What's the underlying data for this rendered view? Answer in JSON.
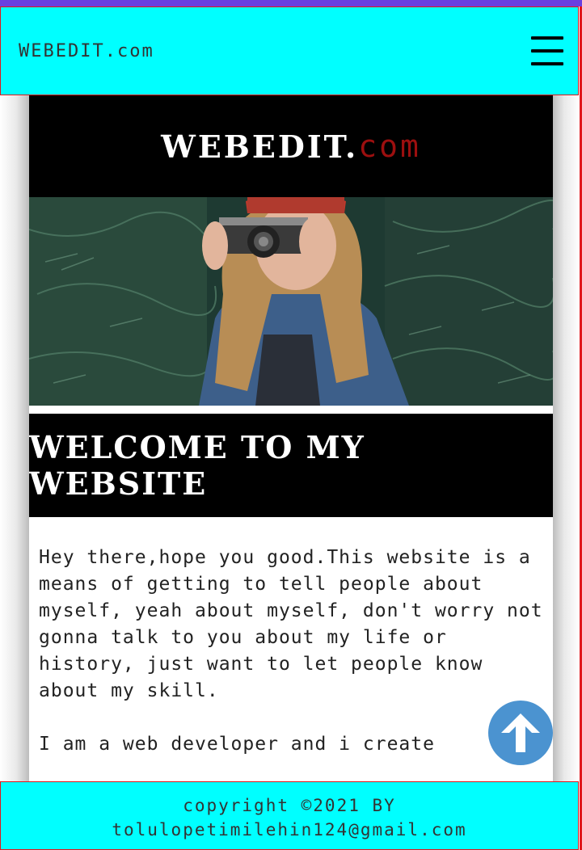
{
  "navbar": {
    "brand": "WEBEDIT.com",
    "menu_icon": "hamburger-menu-icon"
  },
  "header": {
    "title_main": "WEBEDIT.",
    "title_accent": "com"
  },
  "hero": {
    "image": "woman-with-camera-photo"
  },
  "welcome": {
    "heading": "WELCOME TO MY WEBSITE"
  },
  "intro": {
    "paragraph_1": "Hey there,hope you good.This website is a means of getting to tell people about myself, yeah about myself, don't worry not gonna talk to you about my life or history, just want to let people know about my skill.",
    "paragraph_2": "I am a web developer and i create"
  },
  "scroll_top": {
    "icon": "arrow-up-icon"
  },
  "footer": {
    "line_1": "copyright ©2021 BY",
    "line_2": "tolulopetimilehin124@gmail.com"
  },
  "colors": {
    "nav_bg": "#00ffff",
    "border": "#e0161b",
    "accent": "#9c0f0f",
    "scroll_button": "#4b93d0"
  }
}
